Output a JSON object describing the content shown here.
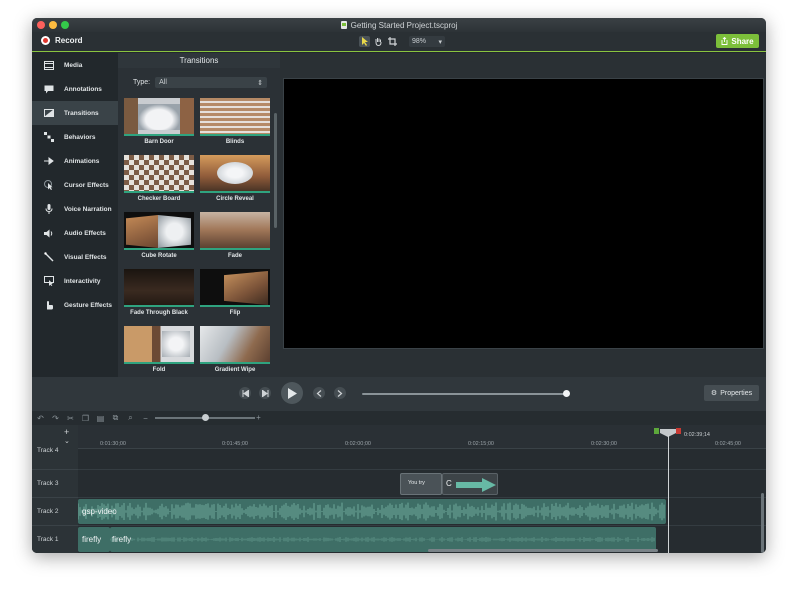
{
  "window": {
    "title": "Getting Started Project.tscproj"
  },
  "toolbar": {
    "record_label": "Record",
    "zoom_value": "98%",
    "share_label": "Share"
  },
  "sidebar": {
    "items": [
      {
        "label": "Media",
        "icon": "film-icon"
      },
      {
        "label": "Annotations",
        "icon": "annotation-icon"
      },
      {
        "label": "Transitions",
        "icon": "transition-icon",
        "active": true
      },
      {
        "label": "Behaviors",
        "icon": "behaviors-icon"
      },
      {
        "label": "Animations",
        "icon": "animation-icon"
      },
      {
        "label": "Cursor Effects",
        "icon": "cursor-icon"
      },
      {
        "label": "Voice Narration",
        "icon": "microphone-icon"
      },
      {
        "label": "Audio Effects",
        "icon": "speaker-icon"
      },
      {
        "label": "Visual Effects",
        "icon": "wand-icon"
      },
      {
        "label": "Interactivity",
        "icon": "interactivity-icon"
      },
      {
        "label": "Gesture Effects",
        "icon": "hand-icon"
      }
    ]
  },
  "transitions": {
    "title": "Transitions",
    "type_label": "Type:",
    "type_value": "All",
    "items": [
      {
        "label": "Barn Door"
      },
      {
        "label": "Blinds"
      },
      {
        "label": "Checker Board"
      },
      {
        "label": "Circle Reveal"
      },
      {
        "label": "Cube Rotate"
      },
      {
        "label": "Fade"
      },
      {
        "label": "Fade Through Black"
      },
      {
        "label": "Flip"
      },
      {
        "label": "Fold"
      },
      {
        "label": "Gradient Wipe"
      }
    ]
  },
  "playback": {
    "properties_label": "Properties"
  },
  "timeline": {
    "ruler_ticks": [
      "0:01:30;00",
      "0:01:45;00",
      "0:02:00;00",
      "0:02:15;00",
      "0:02:30;00",
      "0:02:45;00"
    ],
    "playhead_time": "0:02:39;14",
    "tracks": [
      {
        "label": "Track 4"
      },
      {
        "label": "Track 3"
      },
      {
        "label": "Track 2"
      },
      {
        "label": "Track 1"
      }
    ],
    "clips": {
      "callout_text": "You try",
      "callout_letter": "C",
      "video_clip": "gsp-video",
      "audio_clip_a": "firefly",
      "audio_clip_b": "firefly"
    }
  },
  "colors": {
    "accent": "#7cbf3a",
    "record": "#e0382f",
    "clip_teal": "#3e6e66",
    "transition_bar": "#2fa37f"
  }
}
